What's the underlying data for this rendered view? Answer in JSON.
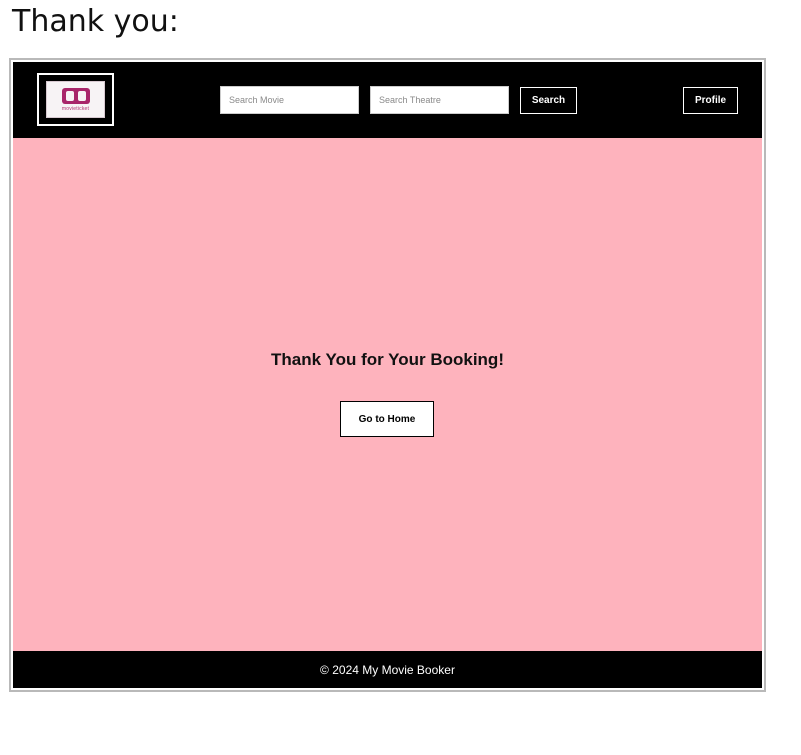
{
  "caption": "Thank you:",
  "header": {
    "logo_text": "movieticket",
    "search_movie_placeholder": "Search Movie",
    "search_theatre_placeholder": "Search Theatre",
    "search_label": "Search",
    "profile_label": "Profile"
  },
  "main": {
    "heading": "Thank You for Your Booking!",
    "home_button_label": "Go to Home"
  },
  "footer": {
    "text": "© 2024 My Movie Booker"
  },
  "colors": {
    "header_bg": "#000000",
    "content_bg": "#feb3bd",
    "brand_accent": "#b0306f"
  }
}
